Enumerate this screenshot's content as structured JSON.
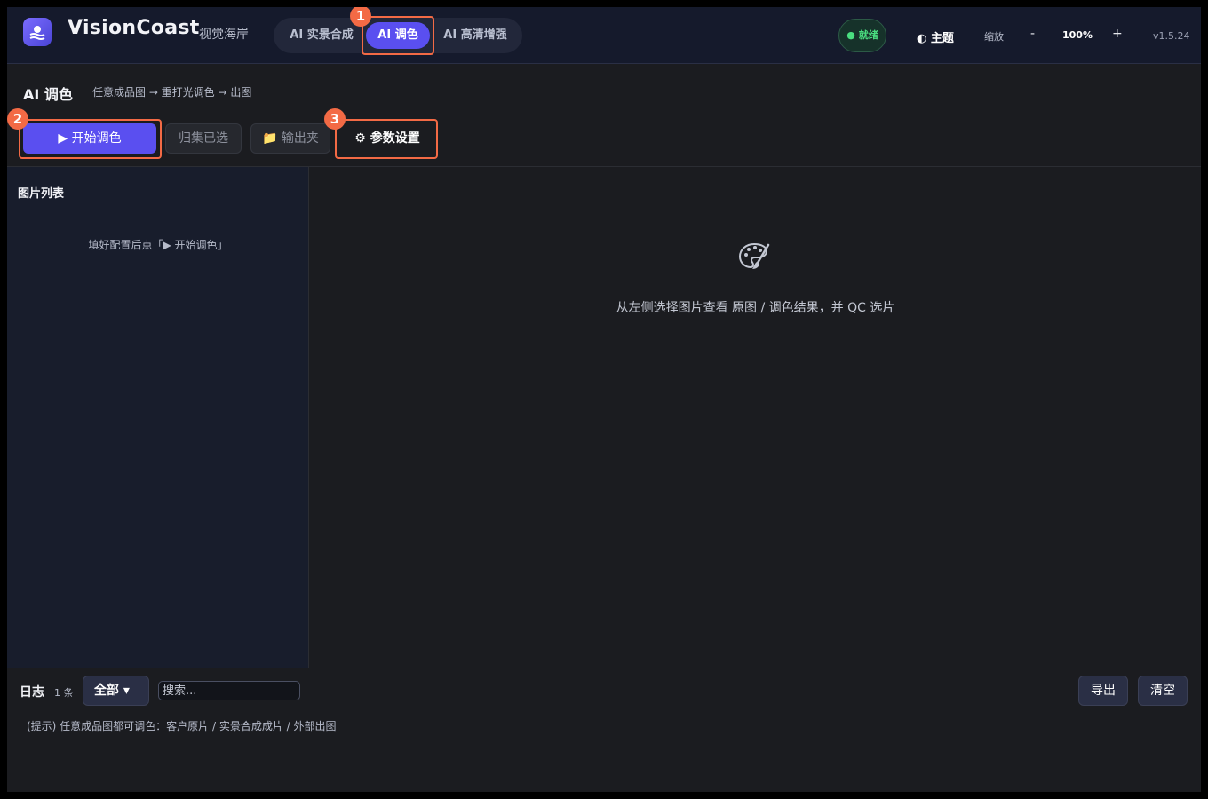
{
  "header": {
    "brand": "VisionCoast",
    "brand_sub": "视觉海岸",
    "tabs": [
      {
        "label": "AI 实景合成"
      },
      {
        "label": "AI 调色"
      },
      {
        "label": "AI 高清增强"
      }
    ],
    "status": "● 就绪",
    "theme_label": "◐ 主题",
    "zoom_label": "缩放",
    "zoom_minus": "-",
    "zoom_value": "100%",
    "zoom_plus": "+",
    "version": "v1.5.24"
  },
  "page": {
    "title": "AI 调色",
    "description": "任意成品图 → 重打光调色 → 出图"
  },
  "toolbar": {
    "start_label": "▶  开始调色",
    "collect_label": "归集已选",
    "output_label": "📁 输出夹",
    "settings_label": "⚙  参数设置"
  },
  "annotations": [
    "1",
    "2",
    "3"
  ],
  "sidebar": {
    "title": "图片列表",
    "hint": "填好配置后点「▶ 开始调色」"
  },
  "preview": {
    "icon": "palette-icon",
    "hint": "从左侧选择图片查看 原图 / 调色结果，并 QC 选片"
  },
  "log": {
    "title": "日志",
    "count": "1 条",
    "filter_value": "全部 ▾",
    "search_placeholder": "搜索...",
    "export_label": "导出",
    "clear_label": "清空",
    "lines": [
      "(提示) 任意成品图都可调色：客户原片 / 实景合成成片 / 外部出图"
    ]
  },
  "colors": {
    "accent": "#5a4ff0",
    "highlight": "#f36a45",
    "status_ok": "#4ade80"
  }
}
